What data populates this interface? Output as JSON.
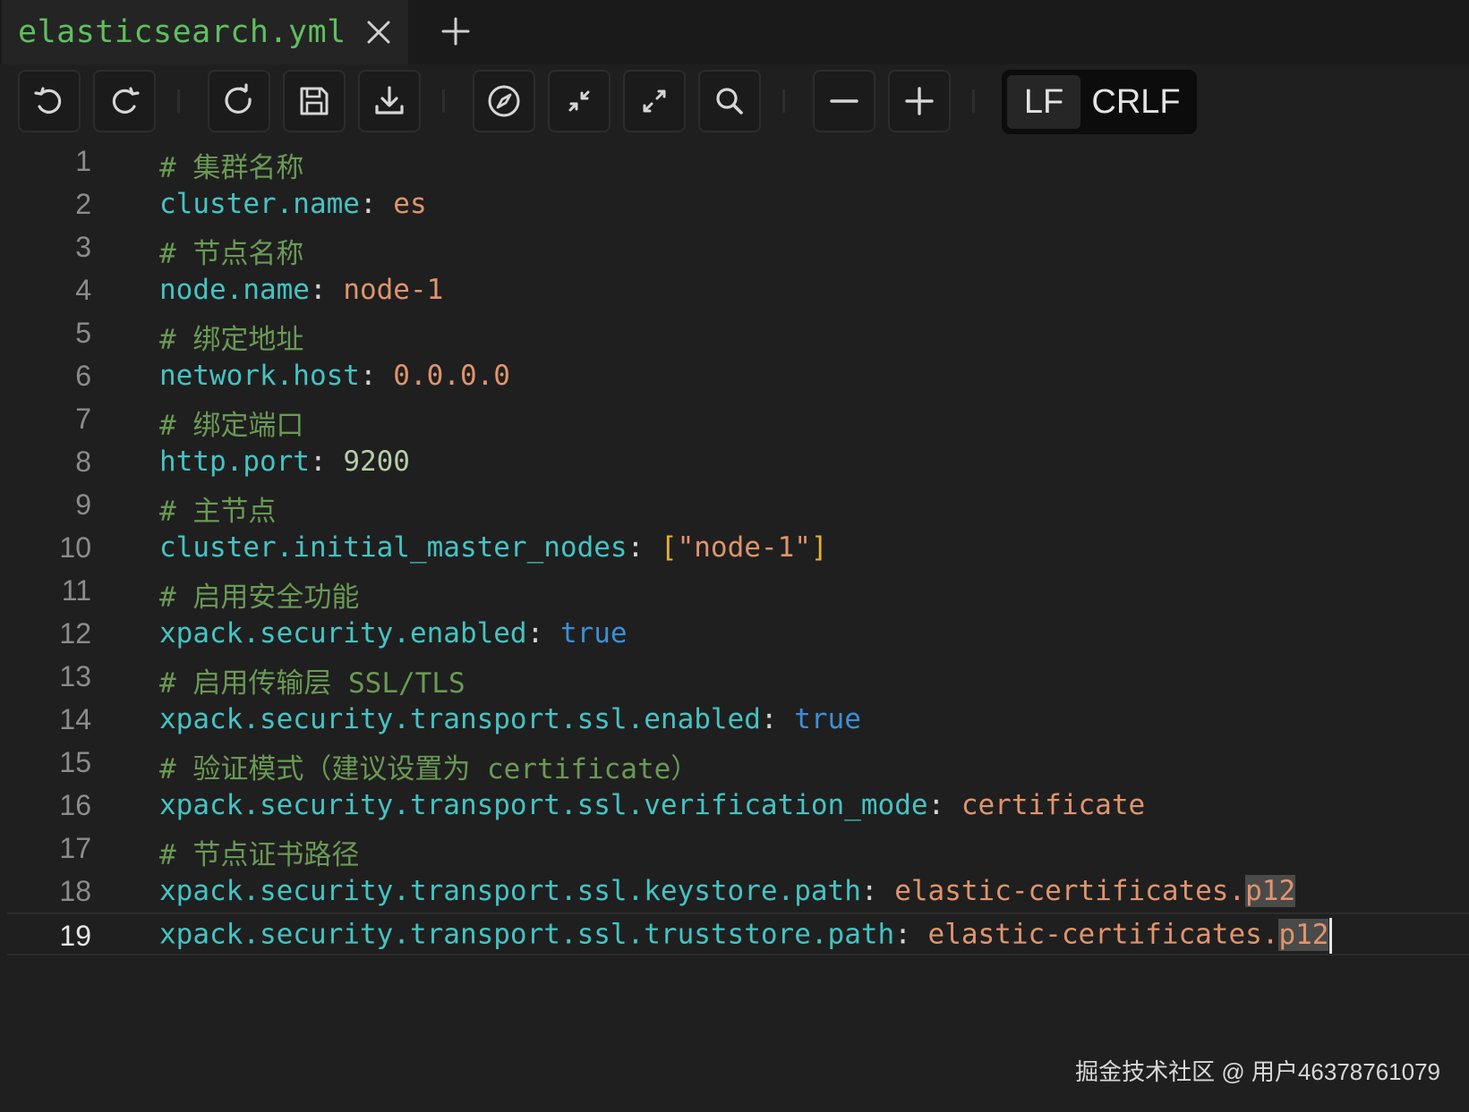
{
  "tab": {
    "title": "elasticsearch.yml"
  },
  "toolbar": {
    "buttons": [
      {
        "name": "undo-button",
        "icon": "undo-icon"
      },
      {
        "name": "redo-button",
        "icon": "redo-icon"
      },
      {
        "name": "reload-button",
        "icon": "reload-icon"
      },
      {
        "name": "save-button",
        "icon": "save-icon"
      },
      {
        "name": "download-button",
        "icon": "download-icon"
      },
      {
        "name": "navigate-button",
        "icon": "compass-icon"
      },
      {
        "name": "collapse-button",
        "icon": "collapse-arrows-icon"
      },
      {
        "name": "expand-button",
        "icon": "expand-arrows-icon"
      },
      {
        "name": "search-button",
        "icon": "search-icon"
      },
      {
        "name": "zoom-out-button",
        "icon": "minus-icon"
      },
      {
        "name": "zoom-in-button",
        "icon": "plus-icon"
      }
    ],
    "eol": {
      "lf": "LF",
      "crlf": "CRLF",
      "selected": "LF"
    }
  },
  "editor": {
    "current_line": 19,
    "lines": [
      {
        "n": "1",
        "comment": "# 集群名称"
      },
      {
        "n": "2",
        "key": "cluster.name",
        "sep": ": ",
        "value": "es"
      },
      {
        "n": "3",
        "comment": "# 节点名称"
      },
      {
        "n": "4",
        "key": "node.name",
        "sep": ": ",
        "value": "node-1"
      },
      {
        "n": "5",
        "comment": "# 绑定地址"
      },
      {
        "n": "6",
        "key": "network.host",
        "sep": ": ",
        "value": "0.0.0.0"
      },
      {
        "n": "7",
        "comment": "# 绑定端口"
      },
      {
        "n": "8",
        "key": "http.port",
        "sep": ": ",
        "value": "9200"
      },
      {
        "n": "9",
        "comment": "# 主节点"
      },
      {
        "n": "10",
        "key": "cluster.initial_master_nodes",
        "sep": ": ",
        "bracket_open": "[",
        "value": "\"node-1\"",
        "bracket_close": "]"
      },
      {
        "n": "11",
        "comment": "# 启用安全功能"
      },
      {
        "n": "12",
        "key": "xpack.security.enabled",
        "sep": ": ",
        "value": "true"
      },
      {
        "n": "13",
        "comment": "# 启用传输层 SSL/TLS"
      },
      {
        "n": "14",
        "key": "xpack.security.transport.ssl.enabled",
        "sep": ": ",
        "value": "true"
      },
      {
        "n": "15",
        "comment": "# 验证模式（建议设置为 certificate）"
      },
      {
        "n": "16",
        "key": "xpack.security.transport.ssl.verification_mode",
        "sep": ": ",
        "value": "certificate"
      },
      {
        "n": "17",
        "comment": "# 节点证书路径"
      },
      {
        "n": "18",
        "key": "xpack.security.transport.ssl.keystore.path",
        "sep": ": ",
        "value": "elastic-certificates.",
        "value_hl": "p12"
      },
      {
        "n": "19",
        "key": "xpack.security.transport.ssl.truststore.path",
        "sep": ": ",
        "value": "elastic-certificates.",
        "value_hl": "p12"
      }
    ]
  },
  "watermark": "掘金技术社区 @ 用户46378761079",
  "colors": {
    "background": "#1f1f1f",
    "comment": "#6a9955",
    "key": "#45c3c3",
    "string": "#e0946d",
    "number": "#b5cea8",
    "boolean": "#3d8ed8",
    "bracket": "#e6b422",
    "tab_title": "#5fbf5f"
  }
}
